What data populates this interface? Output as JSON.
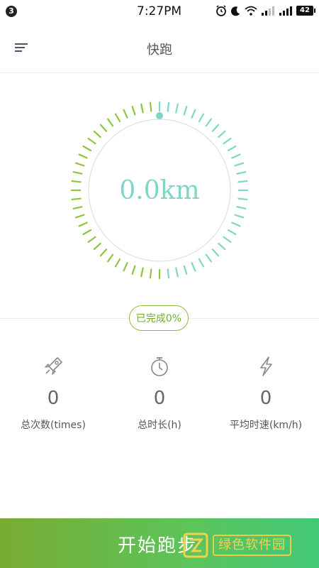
{
  "status_bar": {
    "notification_count": "3",
    "time": "7:27PM",
    "battery": "42"
  },
  "header": {
    "title": "快跑",
    "menu_icon": "menu-icon"
  },
  "ring": {
    "value_text": "0.0km",
    "progress_text": "已完成0%",
    "progress_fraction": 0,
    "accent_color": "#7fd6c6",
    "tick_color_green": "#8cc63f"
  },
  "stats": [
    {
      "icon": "rocket-icon",
      "value": "0",
      "label": "总次数(times)"
    },
    {
      "icon": "stopwatch-icon",
      "value": "0",
      "label": "总时长(h)"
    },
    {
      "icon": "lightning-icon",
      "value": "0",
      "label": "平均时速(km/h)"
    }
  ],
  "start_button": {
    "label": "开始跑步"
  },
  "watermark": {
    "text": "绿色软件园"
  }
}
